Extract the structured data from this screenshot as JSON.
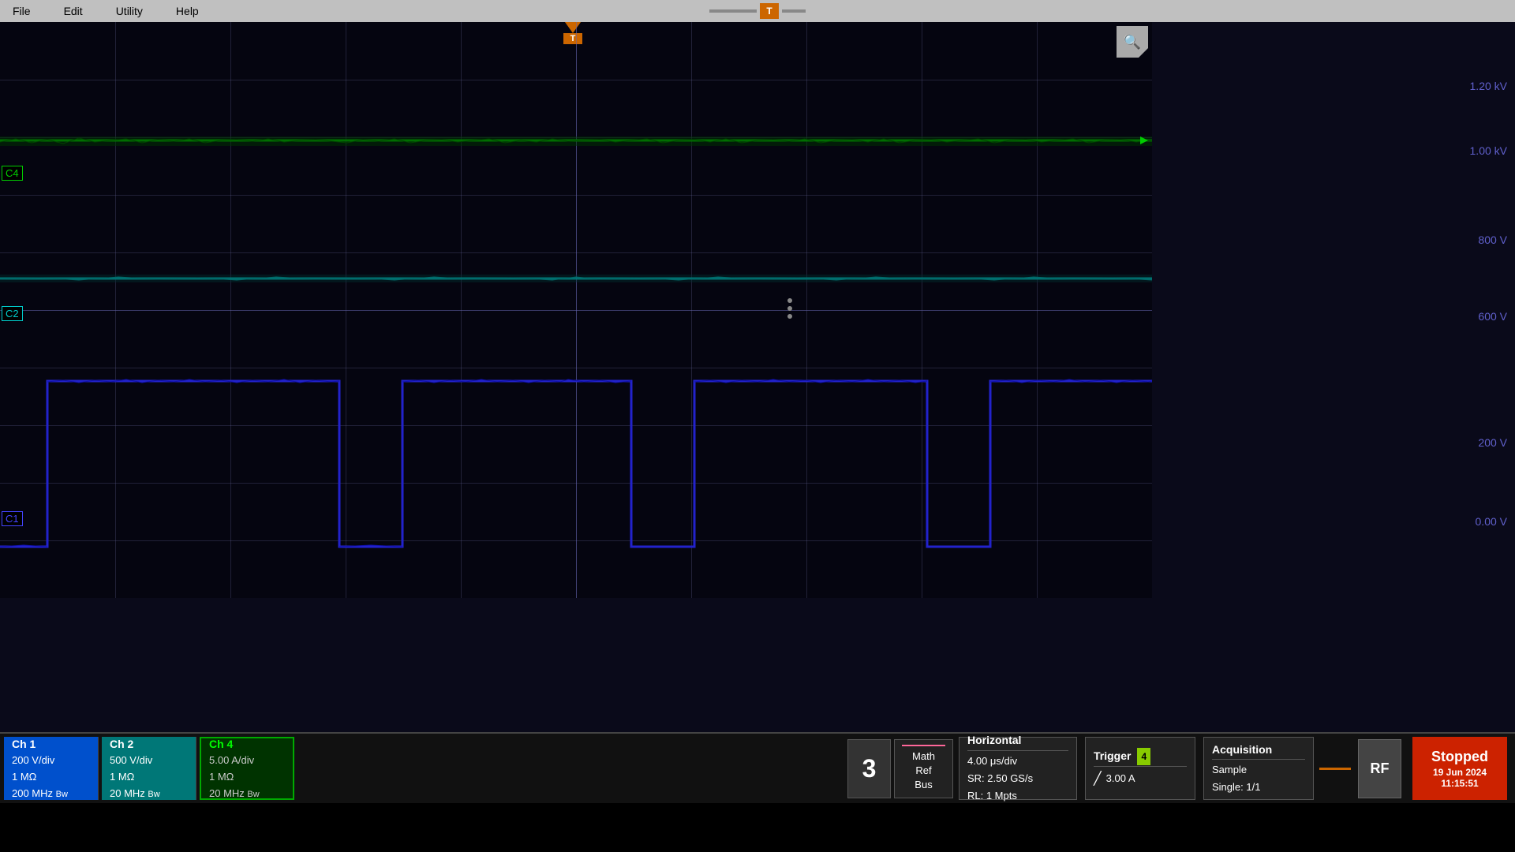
{
  "menubar": {
    "file_label": "File",
    "edit_label": "Edit",
    "utility_label": "Utility",
    "help_label": "Help"
  },
  "scope": {
    "voltage_labels": [
      {
        "value": "1.20 kV",
        "top_pct": 10
      },
      {
        "value": "1.00 kV",
        "top_pct": 22
      },
      {
        "value": "800 V",
        "top_pct": 37
      },
      {
        "value": "600 V",
        "top_pct": 51
      },
      {
        "value": "200 V",
        "top_pct": 72
      },
      {
        "value": "0.00 V",
        "top_pct": 86
      }
    ],
    "channels": {
      "c1_label": "C1",
      "c2_label": "C2",
      "c4_label": "C4"
    }
  },
  "status_bar": {
    "ch1": {
      "label": "Ch 1",
      "vdiv": "200 V/div",
      "impedance": "1 MΩ",
      "bandwidth": "200 MHz",
      "bw_suffix": "Bw"
    },
    "ch2": {
      "label": "Ch 2",
      "vdiv": "500 V/div",
      "impedance": "1 MΩ",
      "bandwidth": "20 MHz",
      "bw_suffix": "Bw"
    },
    "ch4": {
      "label": "Ch 4",
      "vdiv": "5.00 A/div",
      "impedance": "1 MΩ",
      "bandwidth": "20 MHz",
      "bw_suffix": "Bw"
    },
    "number_3": "3",
    "math_ref_bus_label1": "Math",
    "math_ref_bus_label2": "Ref",
    "math_ref_bus_label3": "Bus",
    "horizontal": {
      "title": "Horizontal",
      "time_div": "4.00 μs/div",
      "sr": "SR: 2.50 GS/s",
      "rl": "RL: 1 Mpts"
    },
    "trigger": {
      "title": "Trigger",
      "badge": "4",
      "value": "3.00 A",
      "icon_desc": "rising-edge"
    },
    "acquisition": {
      "title": "Acquisition",
      "mode": "Sample",
      "single": "Single: 1/1"
    },
    "rf_label": "RF",
    "stopped_label": "Stopped",
    "date_label": "19 Jun 2024",
    "time_label": "11:15:51"
  }
}
